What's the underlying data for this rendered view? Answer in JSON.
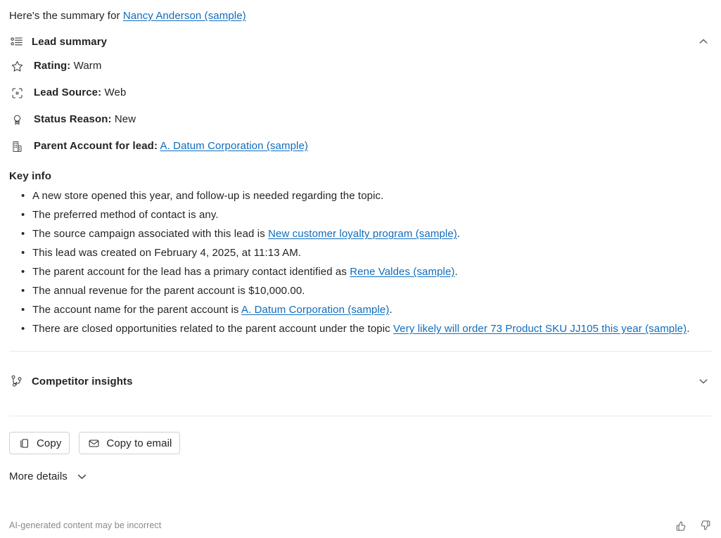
{
  "intro": {
    "prefix": "Here's the summary for ",
    "link": "Nancy Anderson (sample)"
  },
  "lead_summary": {
    "icon": "bulleted-list-icon",
    "title": "Lead summary",
    "expanded": true,
    "collapse_icon": "chevron-up-icon",
    "attributes": [
      {
        "icon": "star-icon",
        "label": "Rating:",
        "value": "Warm",
        "link": null
      },
      {
        "icon": "scan-icon",
        "label": "Lead Source:",
        "value": "Web",
        "link": null
      },
      {
        "icon": "ribbon-icon",
        "label": "Status Reason:",
        "value": "New",
        "link": null
      },
      {
        "icon": "building-icon",
        "label": "Parent Account for lead:",
        "value": "",
        "link": "A. Datum Corporation (sample)"
      }
    ],
    "key_info_title": "Key info",
    "key_info": [
      {
        "pre": "A new store opened this year, and follow-up is needed regarding the topic.",
        "link": null,
        "post": ""
      },
      {
        "pre": "The preferred method of contact is any.",
        "link": null,
        "post": ""
      },
      {
        "pre": "The source campaign associated with this lead is ",
        "link": "New customer loyalty program (sample)",
        "post": "."
      },
      {
        "pre": "This lead was created on February 4, 2025, at 11:13 AM.",
        "link": null,
        "post": ""
      },
      {
        "pre": "The parent account for the lead has a primary contact identified as ",
        "link": "Rene Valdes (sample)",
        "post": "."
      },
      {
        "pre": "The annual revenue for the parent account is $10,000.00.",
        "link": null,
        "post": ""
      },
      {
        "pre": "The account name for the parent account is ",
        "link": "A. Datum Corporation (sample)",
        "post": "."
      },
      {
        "pre": "There are closed opportunities related to the parent account under the topic ",
        "link": "Very likely will order 73 Product SKU JJ105 this year (sample)",
        "post": "."
      }
    ]
  },
  "competitor_insights": {
    "icon": "branch-fork-icon",
    "title": "Competitor insights",
    "expanded": false,
    "expand_icon": "chevron-down-icon"
  },
  "actions": {
    "copy": {
      "label": "Copy",
      "icon": "copy-icon"
    },
    "copy_to_email": {
      "label": "Copy to email",
      "icon": "mail-icon"
    }
  },
  "more_details": {
    "label": "More details",
    "icon": "chevron-down-icon"
  },
  "footer": {
    "disclaimer": "AI-generated content may be incorrect",
    "thumbs_up_icon": "thumbs-up-icon",
    "thumbs_down_icon": "thumbs-down-icon"
  },
  "colors": {
    "link": "#0f6cbd",
    "text": "#242424",
    "muted": "#8a8886",
    "divider": "#ebebeb",
    "border": "#d1d1d1"
  }
}
